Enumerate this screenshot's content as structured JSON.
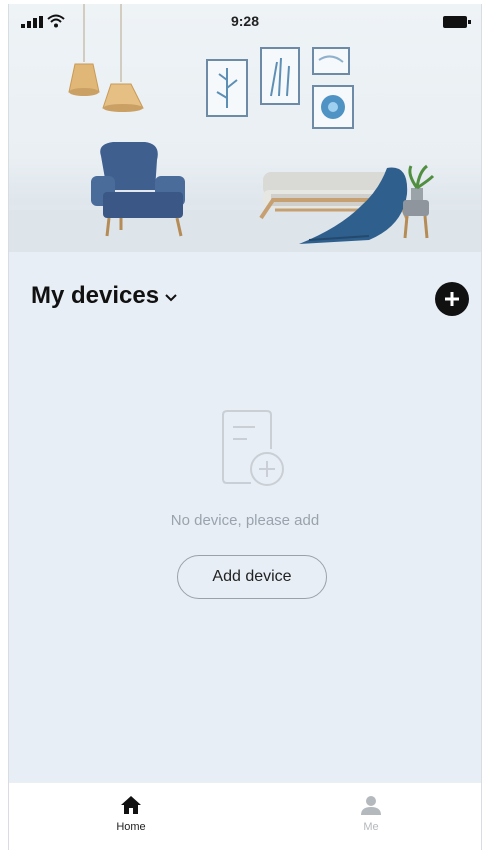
{
  "status_bar": {
    "time": "9:28"
  },
  "devices": {
    "title": "My devices",
    "empty_message": "No device, please add",
    "add_button_label": "Add device"
  },
  "tab_bar": {
    "tabs": [
      {
        "label": "Home",
        "icon": "home-icon",
        "active": true
      },
      {
        "label": "Me",
        "icon": "person-icon",
        "active": false
      }
    ]
  },
  "colors": {
    "background": "#e8eef5",
    "sofa_blue": "#3f5f8f",
    "text_dark": "#111111",
    "muted_text": "#9aa3ad"
  }
}
